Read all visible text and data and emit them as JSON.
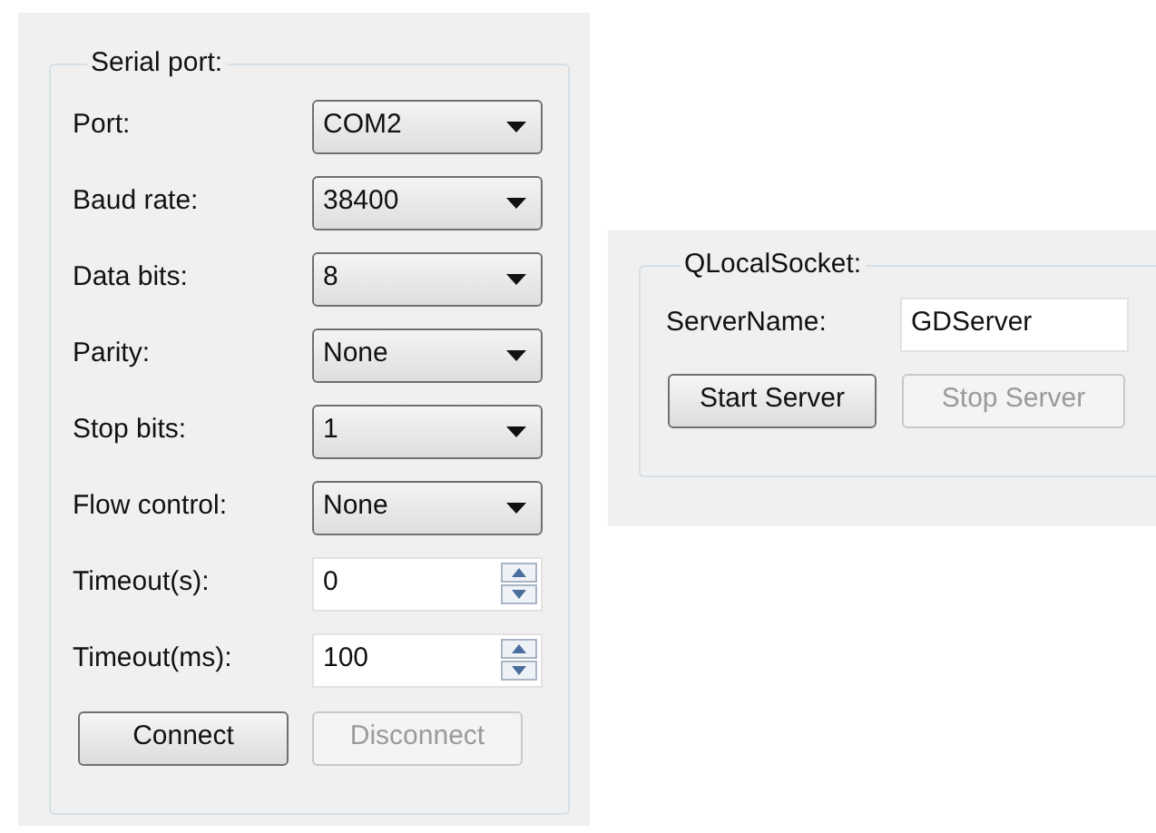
{
  "serial_port": {
    "title": "Serial port:",
    "rows": [
      {
        "kind": "combo",
        "label": "Port:",
        "value": "COM2"
      },
      {
        "kind": "combo",
        "label": "Baud rate:",
        "value": "38400"
      },
      {
        "kind": "combo",
        "label": "Data bits:",
        "value": "8"
      },
      {
        "kind": "combo",
        "label": "Parity:",
        "value": "None"
      },
      {
        "kind": "combo",
        "label": "Stop bits:",
        "value": "1"
      },
      {
        "kind": "combo",
        "label": "Flow control:",
        "value": "None"
      },
      {
        "kind": "spin",
        "label": "Timeout(s):",
        "value": "0"
      },
      {
        "kind": "spin",
        "label": "Timeout(ms):",
        "value": "100"
      }
    ],
    "buttons": [
      {
        "label": "Connect",
        "disabled": false
      },
      {
        "label": "Disconnect",
        "disabled": true
      }
    ]
  },
  "local_socket": {
    "title": "QLocalSocket:",
    "server_name": {
      "label": "ServerName:",
      "value": "GDServer"
    },
    "buttons": [
      {
        "label": "Start Server",
        "disabled": false
      },
      {
        "label": "Stop Server",
        "disabled": true
      }
    ]
  }
}
